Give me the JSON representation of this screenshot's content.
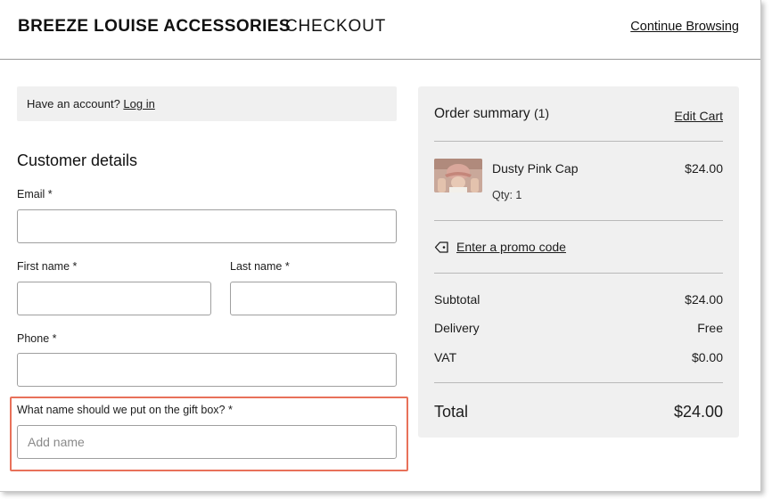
{
  "header": {
    "brand": "BREEZE LOUISE ACCESSORIES",
    "section": "CHECKOUT",
    "continue_label": "Continue Browsing"
  },
  "account": {
    "prompt": "Have an account?",
    "login_label": "Log in"
  },
  "customer": {
    "title": "Customer details",
    "email_label": "Email *",
    "email_value": "",
    "first_name_label": "First name *",
    "first_name_value": "",
    "last_name_label": "Last name *",
    "last_name_value": "",
    "phone_label": "Phone *",
    "phone_value": "",
    "gift_label": "What name should we put on the gift box? *",
    "gift_placeholder": "Add name",
    "gift_value": ""
  },
  "summary": {
    "title": "Order summary",
    "count": "(1)",
    "edit_label": "Edit Cart",
    "item": {
      "name": "Dusty Pink Cap",
      "qty": "Qty: 1",
      "price": "$24.00"
    },
    "promo_label": "Enter a promo code",
    "subtotal_label": "Subtotal",
    "subtotal_value": "$24.00",
    "delivery_label": "Delivery",
    "delivery_value": "Free",
    "vat_label": "VAT",
    "vat_value": "$0.00",
    "total_label": "Total",
    "total_value": "$24.00"
  },
  "colors": {
    "highlight": "#e8715a",
    "panel": "#f0f0f0"
  }
}
